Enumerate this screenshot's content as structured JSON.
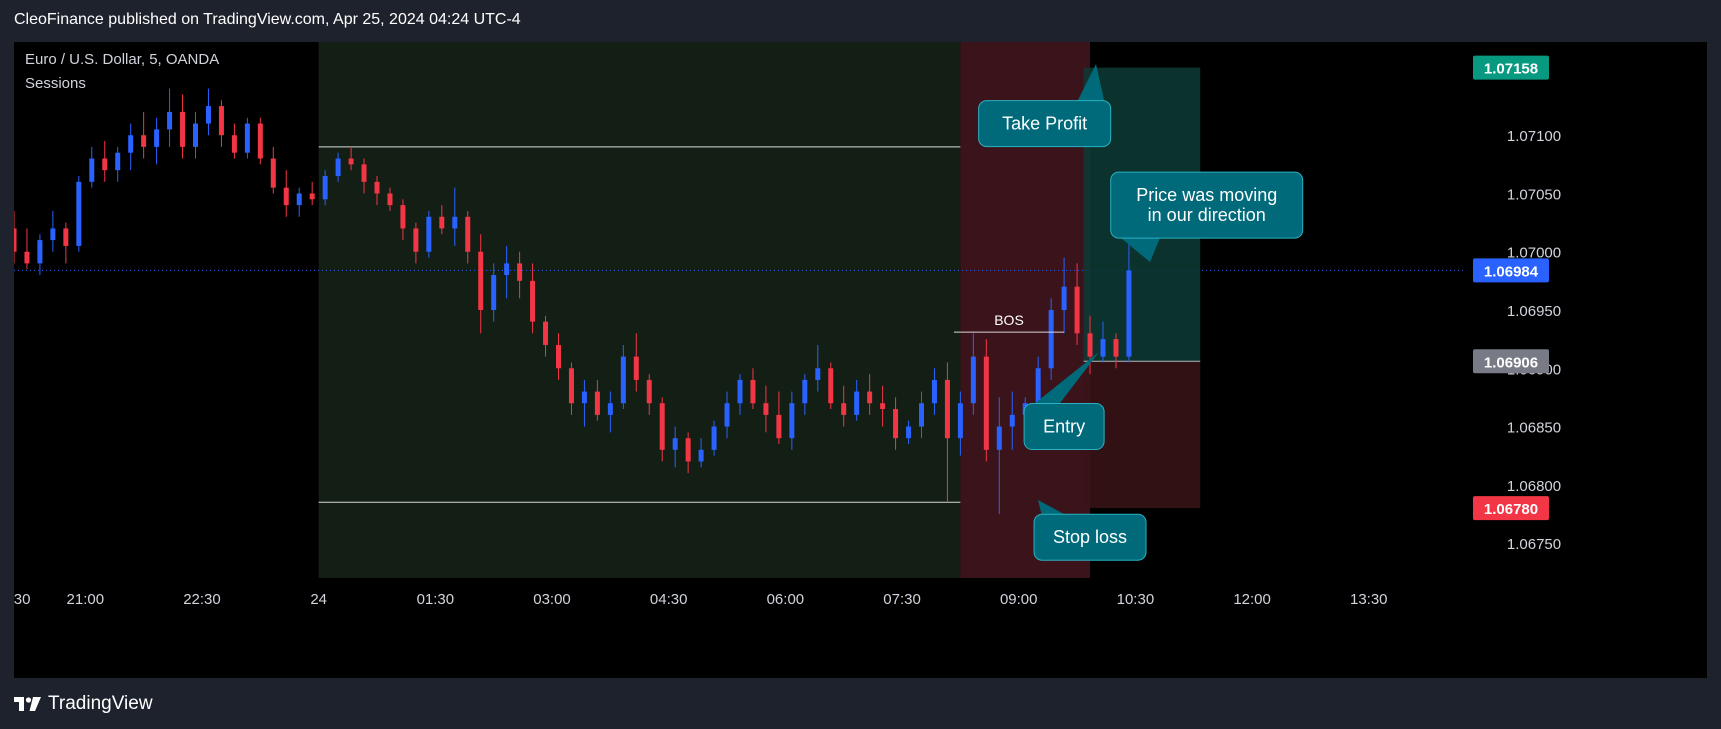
{
  "header": {
    "publisher_line": "CleoFinance published on TradingView.com, Apr 25, 2024 04:24 UTC-4"
  },
  "footer": {
    "brand": "TradingView",
    "brand_icon": "tradingview-logo-icon"
  },
  "colors": {
    "bull": "#2962ff",
    "bear": "#f23645",
    "grid_text": "#d1d4dc",
    "session_asia": "#1a2a1c",
    "session_london": "#4a1820",
    "target_zone": "#0d3b35",
    "stop_zone": "#3a1418",
    "callout": "#006a7a",
    "callout_border": "#2ab0c0",
    "tp_badge": "#089981",
    "sl_badge": "#f23645",
    "last_badge": "#2962ff",
    "entry_badge": "#787b86"
  },
  "chart_data": {
    "type": "candlestick",
    "instrument": "Euro / U.S. Dollar, 5, OANDA",
    "indicator": "Sessions",
    "x_ticks": [
      ":30",
      "21:00",
      "22:30",
      "24",
      "01:30",
      "03:00",
      "04:30",
      "06:00",
      "07:30",
      "09:00",
      "10:30",
      "12:00",
      "13:30"
    ],
    "y_ticks": [
      1.0675,
      1.068,
      1.0685,
      1.069,
      1.0695,
      1.07,
      1.0705,
      1.071
    ],
    "y_tick_labels": [
      "1.06750",
      "1.06800",
      "1.06850",
      "1.06900",
      "1.06950",
      "1.07000",
      "1.07050",
      "1.07100"
    ],
    "ylim": [
      1.0672,
      1.0718
    ],
    "x_range": [
      "20:05",
      "14:45"
    ],
    "sessions": [
      {
        "start": "00:00",
        "end": "08:15",
        "kind": "asia"
      },
      {
        "start": "08:15",
        "end": "09:55",
        "kind": "london"
      }
    ],
    "range_lines": [
      {
        "start": "00:00",
        "end": "08:15",
        "price": 1.0709
      },
      {
        "start": "00:00",
        "end": "08:15",
        "price": 1.06785
      }
    ],
    "bos": {
      "label": "BOS",
      "start": "08:10",
      "end": "09:35",
      "price": 1.06931
    },
    "trade": {
      "start": "09:50",
      "end": "11:20",
      "entry": 1.06906,
      "take_profit": 1.07158,
      "stop_loss": 1.0678,
      "entry_label": "1.06906",
      "tp_label": "1.07158",
      "sl_label": "1.06780"
    },
    "last_price": 1.06984,
    "last_price_label": "1.06984",
    "annotations": [
      {
        "text": "Take Profit",
        "time": "09:20",
        "price": 1.0711
      },
      {
        "text": "Price was moving\nin our direction",
        "time": "11:25",
        "price": 1.0704
      },
      {
        "text": "Entry",
        "time": "09:35",
        "price": 1.0685
      },
      {
        "text": "Stop loss",
        "time": "09:55",
        "price": 1.06755
      }
    ],
    "candles": [
      {
        "t": "20:05",
        "o": 1.0702,
        "h": 1.07035,
        "l": 1.0699,
        "c": 1.07
      },
      {
        "t": "20:15",
        "o": 1.07,
        "h": 1.0702,
        "l": 1.06985,
        "c": 1.0699
      },
      {
        "t": "20:25",
        "o": 1.0699,
        "h": 1.07015,
        "l": 1.0698,
        "c": 1.0701
      },
      {
        "t": "20:35",
        "o": 1.0701,
        "h": 1.07035,
        "l": 1.07,
        "c": 1.0702
      },
      {
        "t": "20:45",
        "o": 1.0702,
        "h": 1.07025,
        "l": 1.0699,
        "c": 1.07005
      },
      {
        "t": "20:55",
        "o": 1.07005,
        "h": 1.07065,
        "l": 1.07,
        "c": 1.0706
      },
      {
        "t": "21:05",
        "o": 1.0706,
        "h": 1.0709,
        "l": 1.07055,
        "c": 1.0708
      },
      {
        "t": "21:15",
        "o": 1.0708,
        "h": 1.07095,
        "l": 1.0706,
        "c": 1.0707
      },
      {
        "t": "21:25",
        "o": 1.0707,
        "h": 1.0709,
        "l": 1.0706,
        "c": 1.07085
      },
      {
        "t": "21:35",
        "o": 1.07085,
        "h": 1.0711,
        "l": 1.0707,
        "c": 1.071
      },
      {
        "t": "21:45",
        "o": 1.071,
        "h": 1.0712,
        "l": 1.0708,
        "c": 1.0709
      },
      {
        "t": "21:55",
        "o": 1.0709,
        "h": 1.07115,
        "l": 1.07075,
        "c": 1.07105
      },
      {
        "t": "22:05",
        "o": 1.07105,
        "h": 1.0714,
        "l": 1.0709,
        "c": 1.0712
      },
      {
        "t": "22:15",
        "o": 1.0712,
        "h": 1.07135,
        "l": 1.0708,
        "c": 1.0709
      },
      {
        "t": "22:25",
        "o": 1.0709,
        "h": 1.0712,
        "l": 1.0708,
        "c": 1.0711
      },
      {
        "t": "22:35",
        "o": 1.0711,
        "h": 1.0714,
        "l": 1.071,
        "c": 1.07125
      },
      {
        "t": "22:45",
        "o": 1.07125,
        "h": 1.0713,
        "l": 1.0709,
        "c": 1.071
      },
      {
        "t": "22:55",
        "o": 1.071,
        "h": 1.0711,
        "l": 1.0708,
        "c": 1.07085
      },
      {
        "t": "23:05",
        "o": 1.07085,
        "h": 1.07115,
        "l": 1.0708,
        "c": 1.0711
      },
      {
        "t": "23:15",
        "o": 1.0711,
        "h": 1.07115,
        "l": 1.07075,
        "c": 1.0708
      },
      {
        "t": "23:25",
        "o": 1.0708,
        "h": 1.0709,
        "l": 1.0705,
        "c": 1.07055
      },
      {
        "t": "23:35",
        "o": 1.07055,
        "h": 1.0707,
        "l": 1.0703,
        "c": 1.0704
      },
      {
        "t": "23:45",
        "o": 1.0704,
        "h": 1.07055,
        "l": 1.0703,
        "c": 1.0705
      },
      {
        "t": "23:55",
        "o": 1.0705,
        "h": 1.0706,
        "l": 1.0704,
        "c": 1.07045
      },
      {
        "t": "00:05",
        "o": 1.07045,
        "h": 1.0707,
        "l": 1.0704,
        "c": 1.07065
      },
      {
        "t": "00:15",
        "o": 1.07065,
        "h": 1.07085,
        "l": 1.0706,
        "c": 1.0708
      },
      {
        "t": "00:25",
        "o": 1.0708,
        "h": 1.0709,
        "l": 1.0707,
        "c": 1.07075
      },
      {
        "t": "00:35",
        "o": 1.07075,
        "h": 1.0708,
        "l": 1.0705,
        "c": 1.0706
      },
      {
        "t": "00:45",
        "o": 1.0706,
        "h": 1.07065,
        "l": 1.0704,
        "c": 1.0705
      },
      {
        "t": "00:55",
        "o": 1.0705,
        "h": 1.07055,
        "l": 1.07035,
        "c": 1.0704
      },
      {
        "t": "01:05",
        "o": 1.0704,
        "h": 1.07045,
        "l": 1.0701,
        "c": 1.0702
      },
      {
        "t": "01:15",
        "o": 1.0702,
        "h": 1.07025,
        "l": 1.0699,
        "c": 1.07
      },
      {
        "t": "01:25",
        "o": 1.07,
        "h": 1.07035,
        "l": 1.06995,
        "c": 1.0703
      },
      {
        "t": "01:35",
        "o": 1.0703,
        "h": 1.0704,
        "l": 1.07015,
        "c": 1.0702
      },
      {
        "t": "01:45",
        "o": 1.0702,
        "h": 1.07055,
        "l": 1.07005,
        "c": 1.0703
      },
      {
        "t": "01:55",
        "o": 1.0703,
        "h": 1.07035,
        "l": 1.0699,
        "c": 1.07
      },
      {
        "t": "02:05",
        "o": 1.07,
        "h": 1.07015,
        "l": 1.0693,
        "c": 1.0695
      },
      {
        "t": "02:15",
        "o": 1.0695,
        "h": 1.0699,
        "l": 1.0694,
        "c": 1.0698
      },
      {
        "t": "02:25",
        "o": 1.0698,
        "h": 1.07005,
        "l": 1.0696,
        "c": 1.0699
      },
      {
        "t": "02:35",
        "o": 1.0699,
        "h": 1.07,
        "l": 1.0696,
        "c": 1.06975
      },
      {
        "t": "02:45",
        "o": 1.06975,
        "h": 1.0699,
        "l": 1.0693,
        "c": 1.0694
      },
      {
        "t": "02:55",
        "o": 1.0694,
        "h": 1.06945,
        "l": 1.0691,
        "c": 1.0692
      },
      {
        "t": "03:05",
        "o": 1.0692,
        "h": 1.0693,
        "l": 1.0689,
        "c": 1.069
      },
      {
        "t": "03:15",
        "o": 1.069,
        "h": 1.06905,
        "l": 1.0686,
        "c": 1.0687
      },
      {
        "t": "03:25",
        "o": 1.0687,
        "h": 1.0689,
        "l": 1.0685,
        "c": 1.0688
      },
      {
        "t": "03:35",
        "o": 1.0688,
        "h": 1.0689,
        "l": 1.06855,
        "c": 1.0686
      },
      {
        "t": "03:45",
        "o": 1.0686,
        "h": 1.0688,
        "l": 1.06845,
        "c": 1.0687
      },
      {
        "t": "03:55",
        "o": 1.0687,
        "h": 1.0692,
        "l": 1.06865,
        "c": 1.0691
      },
      {
        "t": "04:05",
        "o": 1.0691,
        "h": 1.0693,
        "l": 1.0688,
        "c": 1.0689
      },
      {
        "t": "04:15",
        "o": 1.0689,
        "h": 1.06895,
        "l": 1.0686,
        "c": 1.0687
      },
      {
        "t": "04:25",
        "o": 1.0687,
        "h": 1.06875,
        "l": 1.0682,
        "c": 1.0683
      },
      {
        "t": "04:35",
        "o": 1.0683,
        "h": 1.0685,
        "l": 1.06815,
        "c": 1.0684
      },
      {
        "t": "04:45",
        "o": 1.0684,
        "h": 1.06845,
        "l": 1.0681,
        "c": 1.0682
      },
      {
        "t": "04:55",
        "o": 1.0682,
        "h": 1.0684,
        "l": 1.06815,
        "c": 1.0683
      },
      {
        "t": "05:05",
        "o": 1.0683,
        "h": 1.06855,
        "l": 1.06825,
        "c": 1.0685
      },
      {
        "t": "05:15",
        "o": 1.0685,
        "h": 1.0688,
        "l": 1.0684,
        "c": 1.0687
      },
      {
        "t": "05:25",
        "o": 1.0687,
        "h": 1.06895,
        "l": 1.0686,
        "c": 1.0689
      },
      {
        "t": "05:35",
        "o": 1.0689,
        "h": 1.069,
        "l": 1.06865,
        "c": 1.0687
      },
      {
        "t": "05:45",
        "o": 1.0687,
        "h": 1.06885,
        "l": 1.06845,
        "c": 1.0686
      },
      {
        "t": "05:55",
        "o": 1.0686,
        "h": 1.0688,
        "l": 1.06835,
        "c": 1.0684
      },
      {
        "t": "06:05",
        "o": 1.0684,
        "h": 1.0688,
        "l": 1.0683,
        "c": 1.0687
      },
      {
        "t": "06:15",
        "o": 1.0687,
        "h": 1.06895,
        "l": 1.0686,
        "c": 1.0689
      },
      {
        "t": "06:25",
        "o": 1.0689,
        "h": 1.0692,
        "l": 1.0688,
        "c": 1.069
      },
      {
        "t": "06:35",
        "o": 1.069,
        "h": 1.06905,
        "l": 1.06865,
        "c": 1.0687
      },
      {
        "t": "06:45",
        "o": 1.0687,
        "h": 1.06885,
        "l": 1.0685,
        "c": 1.0686
      },
      {
        "t": "06:55",
        "o": 1.0686,
        "h": 1.0689,
        "l": 1.06855,
        "c": 1.0688
      },
      {
        "t": "07:05",
        "o": 1.0688,
        "h": 1.06895,
        "l": 1.0686,
        "c": 1.0687
      },
      {
        "t": "07:15",
        "o": 1.0687,
        "h": 1.06885,
        "l": 1.0685,
        "c": 1.06865
      },
      {
        "t": "07:25",
        "o": 1.06865,
        "h": 1.06875,
        "l": 1.0683,
        "c": 1.0684
      },
      {
        "t": "07:35",
        "o": 1.0684,
        "h": 1.06855,
        "l": 1.06835,
        "c": 1.0685
      },
      {
        "t": "07:45",
        "o": 1.0685,
        "h": 1.0688,
        "l": 1.0684,
        "c": 1.0687
      },
      {
        "t": "07:55",
        "o": 1.0687,
        "h": 1.069,
        "l": 1.0686,
        "c": 1.0689
      },
      {
        "t": "08:05",
        "o": 1.0689,
        "h": 1.06905,
        "l": 1.06785,
        "c": 1.0684
      },
      {
        "t": "08:15",
        "o": 1.0684,
        "h": 1.0688,
        "l": 1.06825,
        "c": 1.0687
      },
      {
        "t": "08:25",
        "o": 1.0687,
        "h": 1.0693,
        "l": 1.0686,
        "c": 1.0691
      },
      {
        "t": "08:35",
        "o": 1.0691,
        "h": 1.06925,
        "l": 1.0682,
        "c": 1.0683
      },
      {
        "t": "08:45",
        "o": 1.0683,
        "h": 1.06875,
        "l": 1.06775,
        "c": 1.0685
      },
      {
        "t": "08:55",
        "o": 1.0685,
        "h": 1.0688,
        "l": 1.0683,
        "c": 1.0686
      },
      {
        "t": "09:05",
        "o": 1.0686,
        "h": 1.06875,
        "l": 1.0685,
        "c": 1.0687
      },
      {
        "t": "09:15",
        "o": 1.0687,
        "h": 1.0691,
        "l": 1.06855,
        "c": 1.069
      },
      {
        "t": "09:25",
        "o": 1.069,
        "h": 1.0696,
        "l": 1.0689,
        "c": 1.0695
      },
      {
        "t": "09:35",
        "o": 1.0695,
        "h": 1.06995,
        "l": 1.0693,
        "c": 1.0697
      },
      {
        "t": "09:45",
        "o": 1.0697,
        "h": 1.0699,
        "l": 1.0692,
        "c": 1.0693
      },
      {
        "t": "09:55",
        "o": 1.0693,
        "h": 1.06945,
        "l": 1.06895,
        "c": 1.0691
      },
      {
        "t": "10:05",
        "o": 1.0691,
        "h": 1.0694,
        "l": 1.06905,
        "c": 1.06925
      },
      {
        "t": "10:15",
        "o": 1.06925,
        "h": 1.0693,
        "l": 1.069,
        "c": 1.0691
      },
      {
        "t": "10:25",
        "o": 1.0691,
        "h": 1.07025,
        "l": 1.06905,
        "c": 1.06984
      }
    ]
  }
}
